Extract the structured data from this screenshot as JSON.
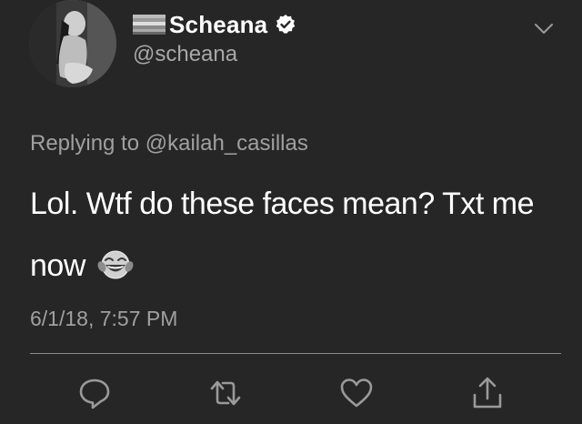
{
  "author": {
    "display_name": "Scheana",
    "handle": "@scheana",
    "verified": true,
    "name_prefix_icon": "flag-icon",
    "avatar": "avatar"
  },
  "reply": {
    "prefix": "Replying to",
    "mention": "@kailah_casillas"
  },
  "tweet": {
    "text": "Lol. Wtf do these faces mean? Txt me now",
    "emoji": "tears-of-joy-emoji"
  },
  "timestamp": "6/1/18, 7:57 PM",
  "actions": [
    {
      "icon": "reply-icon"
    },
    {
      "icon": "retweet-icon"
    },
    {
      "icon": "like-icon"
    },
    {
      "icon": "share-icon"
    }
  ],
  "colors": {
    "background": "#262626",
    "primary_text": "#ffffff",
    "secondary_text": "#a0a0a0",
    "icon": "#9a9a9a"
  }
}
